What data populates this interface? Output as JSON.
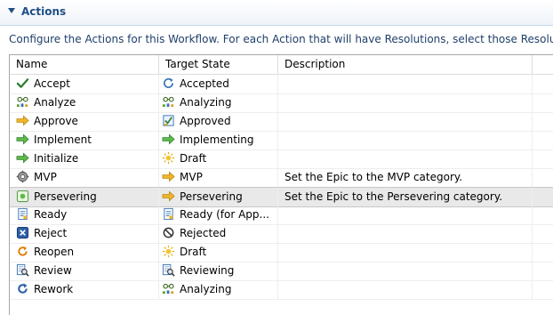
{
  "section": {
    "title": "Actions"
  },
  "description": "Configure the Actions for this Workflow.  For each Action that will have Resolutions, select those Resoluti",
  "table": {
    "columns": [
      "Name",
      "Target State",
      "Description"
    ],
    "rows": [
      {
        "name": "Accept",
        "name_icon": "checkmark-icon",
        "target": "Accepted",
        "target_icon": "refresh-arrow-icon",
        "description": ""
      },
      {
        "name": "Analyze",
        "name_icon": "analyze-icon",
        "target": "Analyzing",
        "target_icon": "analyze-icon",
        "description": ""
      },
      {
        "name": "Approve",
        "name_icon": "arrow-right-yellow-icon",
        "target": "Approved",
        "target_icon": "approved-icon",
        "description": ""
      },
      {
        "name": "Implement",
        "name_icon": "arrow-right-green-icon",
        "target": "Implementing",
        "target_icon": "arrow-right-green-icon",
        "description": ""
      },
      {
        "name": "Initialize",
        "name_icon": "arrow-right-green-icon",
        "target": "Draft",
        "target_icon": "draft-sun-icon",
        "description": ""
      },
      {
        "name": "MVP",
        "name_icon": "gear-icon",
        "target": "MVP",
        "target_icon": "arrow-right-yellow-icon",
        "description": "Set the Epic to the MVP category."
      },
      {
        "name": "Persevering",
        "name_icon": "persevering-icon",
        "target": "Persevering",
        "target_icon": "arrow-right-yellow-icon",
        "description": "Set the Epic to the Persevering category."
      },
      {
        "name": "Ready",
        "name_icon": "ready-document-icon",
        "target": "Ready (for App...",
        "target_icon": "ready-document-icon",
        "description": ""
      },
      {
        "name": "Reject",
        "name_icon": "reject-x-icon",
        "target": "Rejected",
        "target_icon": "rejected-circle-icon",
        "description": ""
      },
      {
        "name": "Reopen",
        "name_icon": "reopen-icon",
        "target": "Draft",
        "target_icon": "draft-sun-icon",
        "description": ""
      },
      {
        "name": "Review",
        "name_icon": "review-magnifier-icon",
        "target": "Reviewing",
        "target_icon": "review-magnifier-icon",
        "description": ""
      },
      {
        "name": "Rework",
        "name_icon": "rework-icon",
        "target": "Analyzing",
        "target_icon": "analyze-icon",
        "description": ""
      }
    ],
    "selected_index": 6
  },
  "colors": {
    "section_title": "#1f4f86",
    "description_text": "#1f3f6a",
    "selected_row": "#e9e9e9"
  }
}
